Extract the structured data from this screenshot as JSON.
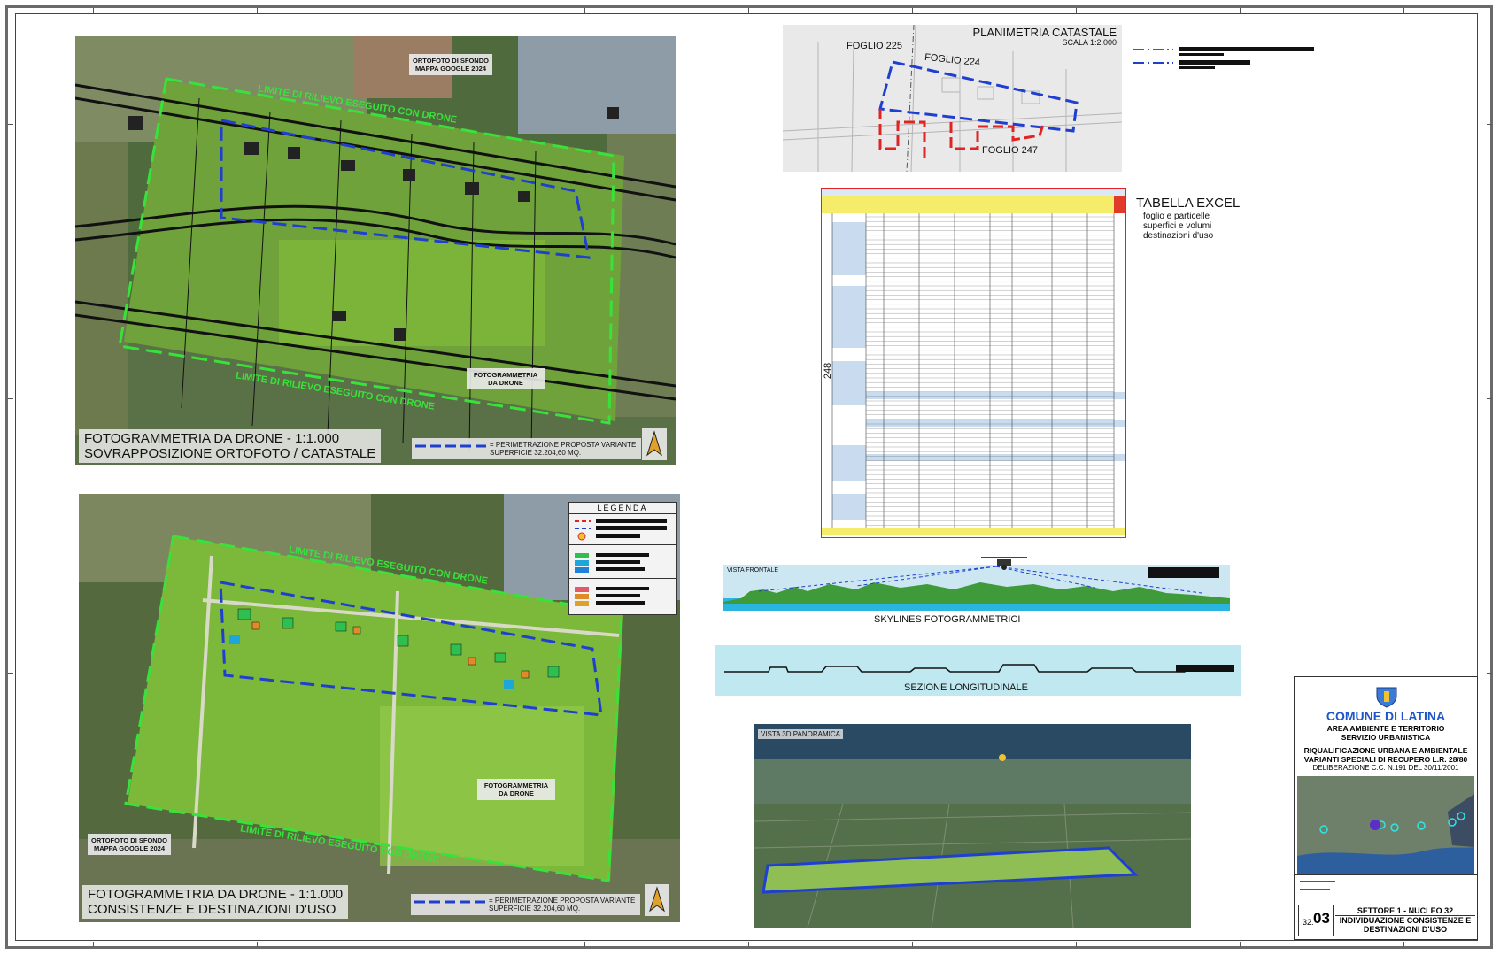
{
  "panel_top": {
    "caption_line1": "FOTOGRAMMETRIA DA DRONE - 1:1.000",
    "caption_line2": "SOVRAPPOSIZIONE ORTOFOTO / CATASTALE",
    "source_line1": "ORTOFOTO DI SFONDO",
    "source_line2": "MAPPA GOOGLE 2024",
    "drone_label_line1": "FOTOGRAMMETRIA",
    "drone_label_line2": "DA DRONE",
    "survey_limit": "LIMITE DI RILIEVO ESEGUITO CON DRONE",
    "legend_line1": "= PERIMETRAZIONE PROPOSTA VARIANTE",
    "legend_line2": "SUPERFICIE 32.204,60 MQ."
  },
  "panel_bottom": {
    "caption_line1": "FOTOGRAMMETRIA DA DRONE - 1:1.000",
    "caption_line2": "CONSISTENZE E DESTINAZIONI D'USO",
    "source_line1": "ORTOFOTO DI SFONDO",
    "source_line2": "MAPPA GOOGLE 2024",
    "drone_label_line1": "FOTOGRAMMETRIA",
    "drone_label_line2": "DA DRONE",
    "survey_limit": "LIMITE DI RILIEVO ESEGUITO CON DRONE",
    "legend_line1": "= PERIMETRAZIONE PROPOSTA VARIANTE",
    "legend_line2": "SUPERFICIE 32.204,60 MQ.",
    "legend_title": "LEGENDA"
  },
  "cadastral": {
    "title": "PLANIMETRIA CATASTALE",
    "scale": "SCALA 1:2.000",
    "foglio_225": "FOGLIO 225",
    "foglio_224": "FOGLIO 224",
    "foglio_247": "FOGLIO 247"
  },
  "excel": {
    "title": "TABELLA EXCEL",
    "subtitle_line1": "foglio e particelle",
    "subtitle_line2": "superfici e volumi",
    "subtitle_line3": "destinazioni d'uso",
    "side_number": "248"
  },
  "skyline": {
    "tag": "VISTA FRONTALE",
    "caption": "SKYLINES FOTOGRAMMETRICI"
  },
  "section": {
    "caption": "SEZIONE LONGITUDINALE"
  },
  "panoramic": {
    "tag": "VISTA 3D PANORAMICA"
  },
  "title_block": {
    "comune": "COMUNE DI LATINA",
    "area": "AREA AMBIENTE E TERRITORIO",
    "servizio": "SERVIZIO URBANISTICA",
    "project_line1": "RIQUALIFICAZIONE URBANA E AMBIENTALE",
    "project_line2": "VARIANTI SPECIALI DI RECUPERO L.R. 28/80",
    "delibera": "DELIBERAZIONE C.C. N.191 DEL 30/11/2001",
    "sheet_prefix": "32.",
    "sheet_number": "03",
    "sector": "SETTORE 1 - NUCLEO 32",
    "desc_line1": "INDIVIDUAZIONE CONSISTENZE E",
    "desc_line2": "DESTINAZIONI D'USO"
  },
  "colors": {
    "perimeter_blue": "#1f3fd0",
    "limit_green": "#39e23a",
    "cadastral_red": "#e02424",
    "title_blue": "#1e56c8"
  }
}
